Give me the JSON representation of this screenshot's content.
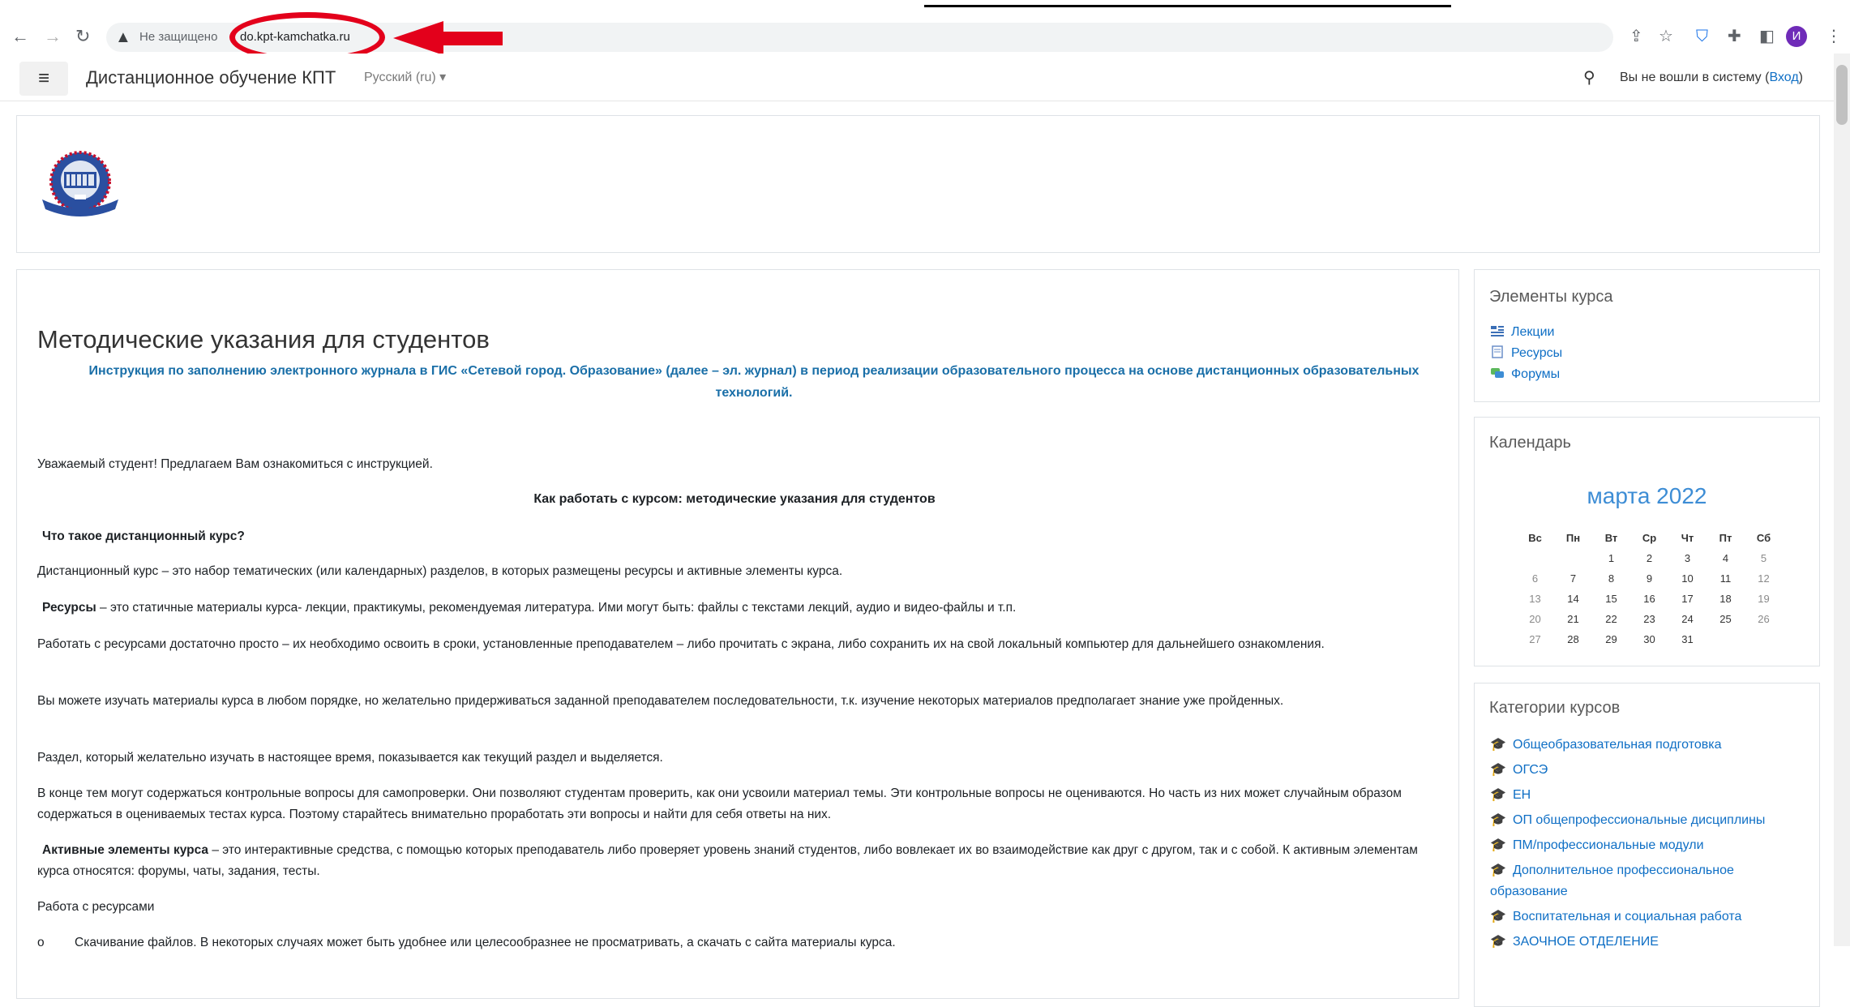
{
  "browser": {
    "insecure_label": "Не защищено",
    "url": "do.kpt-kamchatka.ru",
    "profile_initial": "И",
    "icons": [
      "back-icon",
      "forward-icon",
      "reload-icon",
      "warning-icon",
      "share-icon",
      "star-icon",
      "shield-extension-icon",
      "puzzle-icon",
      "sidepanel-icon",
      "menu-dots-icon"
    ]
  },
  "navbar": {
    "site_name": "Дистанционное обучение КПТ",
    "language": "Русский (ru)",
    "login_text": "Вы не вошли в систему (",
    "login_link": "Вход",
    "login_close": ")"
  },
  "main": {
    "title": "Методические указания для студентов",
    "instruction": "Инструкция по заполнению электронного журнала в ГИС «Сетевой город. Образование» (далее – эл. журнал) в период реализации образовательного процесса на основе дистанционных образовательных технологий.",
    "greeting": "Уважаемый студент! Предлагаем Вам ознакомиться с инструкцией.",
    "how_title": "Как работать с курсом: методические указания для студентов",
    "what_title": "Что такое дистанционный курс?",
    "p_course": "Дистанционный курс – это набор тематических (или календарных) разделов, в которых размещены ресурсы и активные элементы курса.",
    "resources_term": "Ресурсы",
    "resources_text": "  –  это статичные материалы курса- лекции, практикумы, рекомендуемая литература.  Ими могут быть: файлы с текстами лекций,  аудио и видео-файлы  и т.п.",
    "p_work": "Работать с ресурсами достаточно просто – их необходимо освоить в сроки, установленные преподавателем – либо прочитать с экрана, либо сохранить их на свой локальный компьютер для дальнейшего ознакомления.",
    "p_order": "Вы можете изучать материалы курса в любом порядке, но желательно придерживаться заданной преподавателем последовательности, т.к. изучение некоторых материалов предполагает знание уже пройденных.",
    "p_section": "Раздел, который желательно изучать в настоящее время, показывается как текущий раздел и выделяется.",
    "p_control": "В конце тем могут содержаться контрольные вопросы для самопроверки. Они позволяют студентам проверить, как они усвоили материал темы. Эти контрольные вопросы не оцениваются. Но часть из них может случайным образом содержаться в оцениваемых тестах курса. Поэтому старайтесь внимательно проработать эти вопросы  и найти для себя ответы на них.",
    "active_term": "Активные элементы курса",
    "active_text": " – это интерактивные средства, с помощью которых преподаватель либо проверяет уровень знаний студентов, либо вовлекает их во взаимодействие как друг с другом, так и с собой. К активным элементам курса относятся: форумы, чаты, задания, тесты.",
    "work_title": "Работа с ресурсами",
    "bullet_marker": "o",
    "bullet_text": "Скачивание файлов. В некоторых случаях может быть удобнее или целесообразнее не просматривать, а скачать с сайта материалы курса."
  },
  "course_elements": {
    "title": "Элементы курса",
    "items": [
      "Лекции",
      "Ресурсы",
      "Форумы"
    ]
  },
  "calendar": {
    "title": "Календарь",
    "month": "марта 2022",
    "weekdays": [
      "Вс",
      "Пн",
      "Вт",
      "Ср",
      "Чт",
      "Пт",
      "Сб"
    ],
    "weeks": [
      [
        "",
        "",
        "1",
        "2",
        "3",
        "4",
        "5"
      ],
      [
        "6",
        "7",
        "8",
        "9",
        "10",
        "11",
        "12"
      ],
      [
        "13",
        "14",
        "15",
        "16",
        "17",
        "18",
        "19"
      ],
      [
        "20",
        "21",
        "22",
        "23",
        "24",
        "25",
        "26"
      ],
      [
        "27",
        "28",
        "29",
        "30",
        "31",
        "",
        ""
      ]
    ]
  },
  "categories": {
    "title": "Категории курсов",
    "items": [
      "Общеобразовательная подготовка",
      "ОГСЭ",
      "ЕН",
      "ОП общепрофессиональные дисциплины",
      "ПМ/профессиональные модули",
      "Дополнительное профессиональное образование",
      "Воспитательная и социальная работа",
      "ЗАОЧНОЕ ОТДЕЛЕНИЕ"
    ]
  },
  "colors": {
    "link": "#0f6fc5",
    "annotation_red": "#e3001b",
    "instruction_blue": "#1a6fa8",
    "calendar_month": "#3d8dd5"
  }
}
